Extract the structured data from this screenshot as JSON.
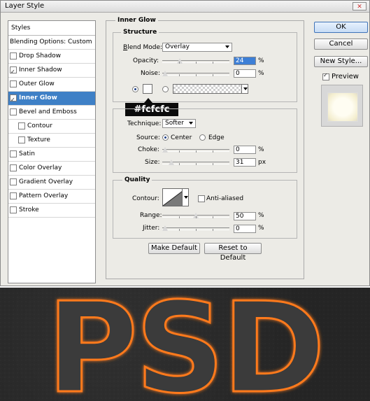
{
  "window": {
    "title": "Layer Style",
    "close_icon": "close-icon"
  },
  "styles_panel": {
    "header": "Styles",
    "items": [
      {
        "label": "Blending Options: Custom",
        "checkbox": false,
        "checked": false,
        "selected": false,
        "indent": false
      },
      {
        "label": "Drop Shadow",
        "checkbox": true,
        "checked": false,
        "selected": false,
        "indent": false
      },
      {
        "label": "Inner Shadow",
        "checkbox": true,
        "checked": true,
        "selected": false,
        "indent": false
      },
      {
        "label": "Outer Glow",
        "checkbox": true,
        "checked": false,
        "selected": false,
        "indent": false
      },
      {
        "label": "Inner Glow",
        "checkbox": true,
        "checked": true,
        "selected": true,
        "indent": false
      },
      {
        "label": "Bevel and Emboss",
        "checkbox": true,
        "checked": false,
        "selected": false,
        "indent": false
      },
      {
        "label": "Contour",
        "checkbox": true,
        "checked": false,
        "selected": false,
        "indent": true
      },
      {
        "label": "Texture",
        "checkbox": true,
        "checked": false,
        "selected": false,
        "indent": true
      },
      {
        "label": "Satin",
        "checkbox": true,
        "checked": false,
        "selected": false,
        "indent": false
      },
      {
        "label": "Color Overlay",
        "checkbox": true,
        "checked": false,
        "selected": false,
        "indent": false
      },
      {
        "label": "Gradient Overlay",
        "checkbox": true,
        "checked": false,
        "selected": false,
        "indent": false
      },
      {
        "label": "Pattern Overlay",
        "checkbox": true,
        "checked": false,
        "selected": false,
        "indent": false
      },
      {
        "label": "Stroke",
        "checkbox": true,
        "checked": false,
        "selected": false,
        "indent": false
      }
    ]
  },
  "inner_glow": {
    "title": "Inner Glow",
    "structure": {
      "title": "Structure",
      "blend_mode_label": "Blend Mode:",
      "blend_mode_value": "Overlay",
      "opacity_label": "Opacity:",
      "opacity_value": "24",
      "opacity_unit": "%",
      "opacity_level": 0.24,
      "noise_label": "Noise:",
      "noise_value": "0",
      "noise_unit": "%",
      "noise_level": 0.0,
      "glow_color": "#fcfcfc",
      "color_callout": "#fcfcfc"
    },
    "elements": {
      "technique_label": "Technique:",
      "technique_value": "Softer",
      "source_label": "Source:",
      "source_center": "Center",
      "source_edge": "Edge",
      "choke_label": "Choke:",
      "choke_value": "0",
      "choke_unit": "%",
      "choke_level": 0.0,
      "size_label": "Size:",
      "size_value": "31",
      "size_unit": "px",
      "size_level": 0.1
    },
    "quality": {
      "title": "Quality",
      "contour_label": "Contour:",
      "anti_aliased_label": "Anti-aliased",
      "range_label": "Range:",
      "range_value": "50",
      "range_unit": "%",
      "range_level": 0.5,
      "jitter_label": "Jitter:",
      "jitter_value": "0",
      "jitter_unit": "%",
      "jitter_level": 0.0
    },
    "make_default": "Make Default",
    "reset_default": "Reset to Default"
  },
  "actions": {
    "ok": "OK",
    "cancel": "Cancel",
    "new_style": "New Style...",
    "preview_label": "Preview",
    "preview_checked": true
  },
  "artwork": {
    "text": "PSD",
    "glow_color": "#ff7a1a"
  }
}
